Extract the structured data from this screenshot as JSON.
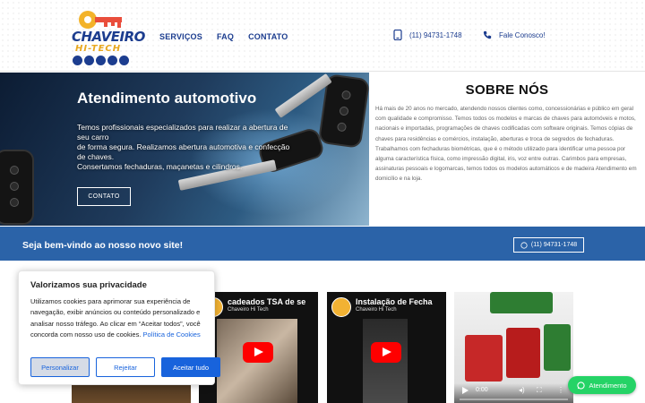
{
  "header": {
    "logo": {
      "line1": "CHAVEIRO",
      "line2": "HI-TECH"
    },
    "nav": [
      {
        "label": "SERVIÇOS"
      },
      {
        "label": "FAQ"
      },
      {
        "label": "CONTATO"
      }
    ],
    "phone": "(11) 94731-1748",
    "contact_label": "Fale Conosco!"
  },
  "hero": {
    "title": "Atendimento automotivo",
    "description_1": "Temos profissionais especializados para realizar a abertura de seu carro",
    "description_2": "de forma segura. Realizamos abertura automotiva e confecção de chaves.",
    "description_3": "Consertamos fechaduras, maçanetas e cilindros.",
    "button_label": "CONTATO"
  },
  "sobre": {
    "title": "SOBRE NÓS",
    "text": "Há mais de 20 anos no mercado, atendendo nossos clientes como, concessionárias e público em geral com qualidade e compromisso. Temos todos os modelos e marcas de chaves para automóveis e motos, nacionais e importadas, programações de chaves codificadas com software originais. Temos cópias de chaves para residências e comércios, instalação, aberturas e troca de segredos de fechaduras. Trabalhamos com fechaduras biométricas, que é o método utilizado para identificar uma pessoa por alguma característica física, como impressão digital, iris, voz entre outras. Carimbos para empresas, assinaturas pessoais e logomarcas, temos todos os modelos automáticos e de madeira Atendimento em domicílio e na loja."
  },
  "banner": {
    "text": "Seja bem-vindo ao nosso novo site!",
    "button_label": "(11) 94731-1748"
  },
  "videos": [
    {
      "title": "cadeados TSA de se",
      "channel": "Chaveiro Hi Tech"
    },
    {
      "title": "Instalação de Fecha",
      "channel": "Chaveiro Hi Tech"
    }
  ],
  "video_player": {
    "time": "0:00"
  },
  "cookie": {
    "title": "Valorizamos sua privacidade",
    "text": "Utilizamos cookies para aprimorar sua experiência de navegação, exibir anúncios ou conteúdo personalizado e analisar nosso tráfego. Ao clicar em “Aceitar todos”, você concorda com nosso uso de cookies.",
    "link": "Política de Cookies",
    "btn_customize": "Personalizar",
    "btn_reject": "Rejeitar",
    "btn_accept": "Aceitar tudo"
  },
  "whatsapp": {
    "label": "Atendimento"
  },
  "colors": {
    "primary": "#1c3d8f",
    "banner": "#2b63a8",
    "cookie_accent": "#1863dc",
    "whatsapp": "#25d366",
    "logo_accent": "#e8a820"
  }
}
